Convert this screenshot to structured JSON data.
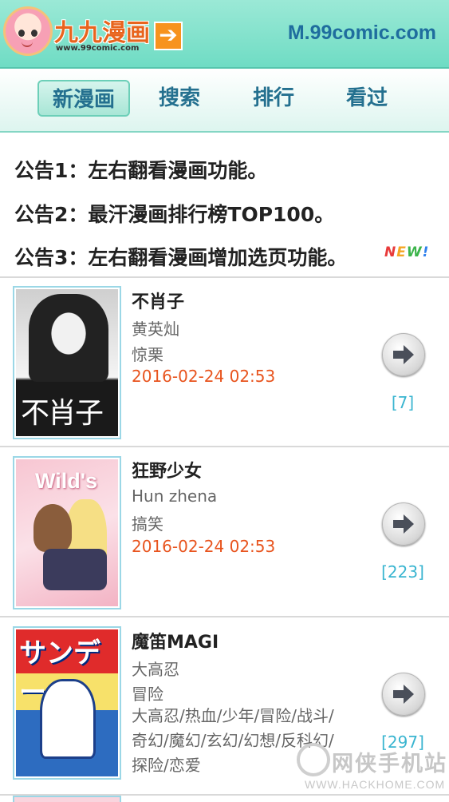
{
  "header": {
    "logo_text": "九九漫画",
    "logo_sub": "www.99comic.com",
    "logo_arrow": "➔",
    "site_url": "M.99comic.com",
    "colors": {
      "bar": "#8be4cf",
      "logo": "#e8641d",
      "url": "#1f6d9e"
    }
  },
  "nav": {
    "items": [
      {
        "label": "新漫画",
        "active": true
      },
      {
        "label": "搜索",
        "active": false
      },
      {
        "label": "排行",
        "active": false
      },
      {
        "label": "看过",
        "active": false
      }
    ]
  },
  "notices": [
    "公告1：左右翻看漫画功能。",
    "公告2：最汗漫画排行榜TOP100。",
    "公告3：左右翻看漫画增加选页功能。"
  ],
  "new_badge": [
    "N",
    "E",
    "W",
    "!"
  ],
  "comics": [
    {
      "title": "不肖子",
      "author": "黄英灿",
      "genre": "惊栗",
      "updated": "2016-02-24 02:53",
      "count": "[7]",
      "cover_text": "不肖子",
      "cover_icon": "cover-image-buxiaozi"
    },
    {
      "title": "狂野少女",
      "author": "Hun zhena",
      "genre": "搞笑",
      "updated": "2016-02-24 02:53",
      "count": "[223]",
      "cover_text": "Wild's",
      "cover_icon": "cover-image-kuangye"
    },
    {
      "title": "魔笛MAGI",
      "author": "大高忍",
      "genre": "冒险",
      "tags": "大高忍/热血/少年/冒险/战斗/奇幻/魔幻/玄幻/幻想/反科幻/探险/恋爱",
      "count": "[297]",
      "cover_text": "サンデー",
      "cover_icon": "cover-image-magi"
    }
  ],
  "watermark": {
    "text": "网侠手机站",
    "sub": "WWW.HACKHOME.COM"
  },
  "icons": {
    "go": "arrow-right-icon"
  }
}
